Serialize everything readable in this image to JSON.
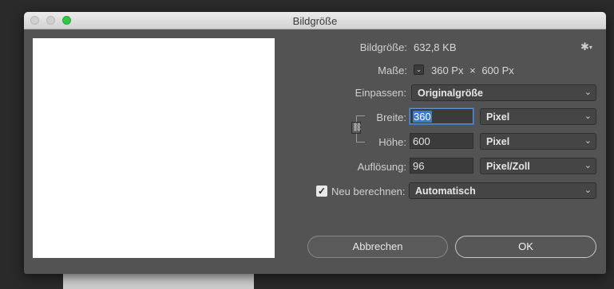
{
  "window": {
    "title": "Bildgröße"
  },
  "info": {
    "size_label": "Bildgröße:",
    "size_value": "632,8 KB",
    "dims_label": "Maße:",
    "dims_width": "360 Px",
    "dims_times": "×",
    "dims_height": "600 Px"
  },
  "fit": {
    "label": "Einpassen:",
    "value": "Originalgröße"
  },
  "width": {
    "label": "Breite:",
    "value": "360",
    "unit": "Pixel"
  },
  "height": {
    "label": "Höhe:",
    "value": "600",
    "unit": "Pixel"
  },
  "resolution": {
    "label": "Auflösung:",
    "value": "96",
    "unit": "Pixel/Zoll"
  },
  "resample": {
    "label": "Neu berechnen:",
    "checked": true,
    "value": "Automatisch"
  },
  "buttons": {
    "cancel": "Abbrechen",
    "ok": "OK"
  },
  "icons": {
    "gear": "gear-icon",
    "chevron": "chevron-down-icon",
    "link": "link-icon",
    "check": "checkmark-icon"
  }
}
